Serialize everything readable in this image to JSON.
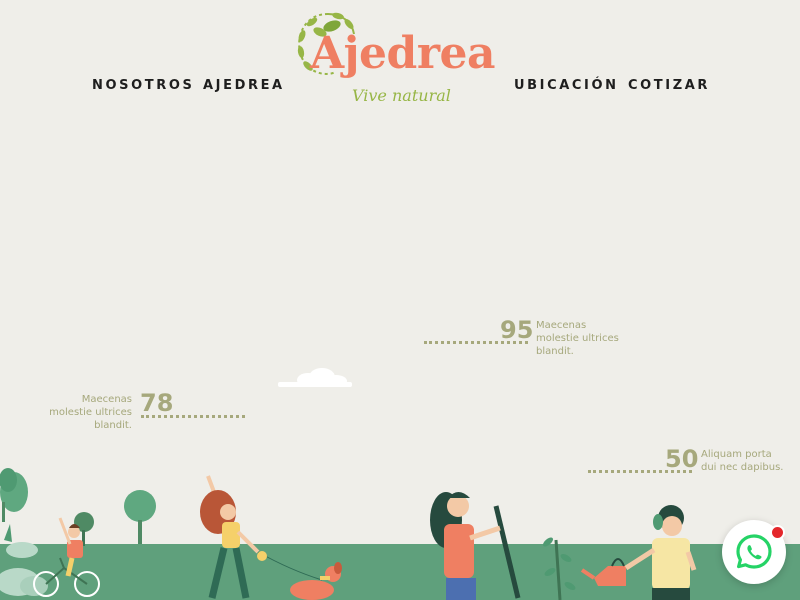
{
  "nav": {
    "left": [
      "NOSOTROS",
      "AJEDREA"
    ],
    "right": [
      "UBICACIÓN",
      "COTIZAR"
    ]
  },
  "logo": {
    "wordmark": "Ajedrea",
    "tagline": "Vive natural",
    "colors": {
      "wordmark": "#ef7f62",
      "leaves": "#97b646"
    }
  },
  "stats": [
    {
      "value": "78",
      "text": "Maecenas molestie ultrices blandit."
    },
    {
      "value": "95",
      "text": "Maecenas molestie ultrices blandit."
    },
    {
      "value": "50",
      "text": "Aliquam porta dui nec dapibus."
    }
  ],
  "whatsapp": {
    "icon": "whatsapp-icon",
    "color": "#25d366",
    "has_notification": true
  },
  "colors": {
    "background": "#efeee9",
    "ground": "#5fa07c",
    "stat": "#a6a87c"
  }
}
